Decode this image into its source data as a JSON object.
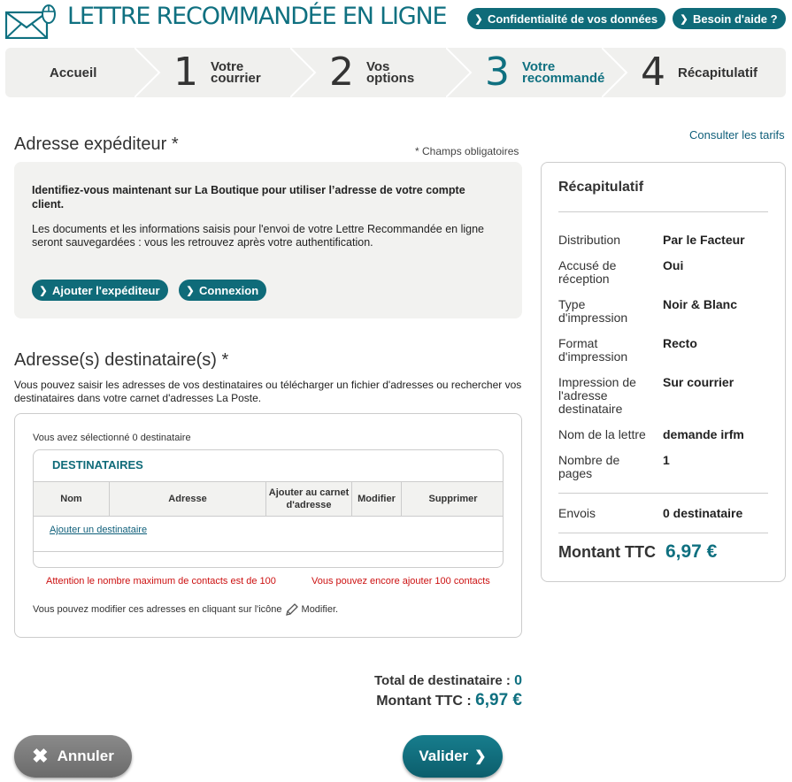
{
  "header": {
    "title": "LETTRE RECOMMANDÉE EN LIGNE",
    "logo_icon": "envelope-mouse-icon",
    "links": {
      "privacy": "Confidentialité de vos données",
      "help": "Besoin d'aide ?"
    }
  },
  "steps": {
    "home": "Accueil",
    "items": [
      {
        "num": "1",
        "label": "Votre courrier",
        "active": false
      },
      {
        "num": "2",
        "label": "Vos options",
        "active": false
      },
      {
        "num": "3",
        "label": "Votre recommandé",
        "active": true
      },
      {
        "num": "4",
        "label": "Récapitulatif",
        "active": false
      }
    ]
  },
  "tarifs_link": "Consulter les tarifs",
  "sender": {
    "title": "Adresse expéditeur *",
    "required_note": "* Champs obligatoires",
    "intro_bold": "Identifiez-vous maintenant sur La Boutique pour utiliser l’adresse de votre compte client.",
    "intro": "Les documents et les informations saisis pour l'envoi de votre Lettre Recommandée en ligne seront sauvegardées : vous les retrouvez après votre authentification.",
    "add_button": "Ajouter l'expéditeur",
    "login_button": "Connexion"
  },
  "recipients": {
    "title": "Adresse(s) destinataire(s) *",
    "intro": "Vous pouvez saisir les adresses de vos destinataires ou télécharger un fichier d'adresses ou rechercher vos destinataires dans votre carnet d'adresses La Poste.",
    "selected_text": "Vous avez sélectionné 0 destinataire",
    "table_title": "DESTINATAIRES",
    "columns": [
      "Nom",
      "Adresse",
      "Ajouter au carnet d'adresse",
      "Modifier",
      "Supprimer"
    ],
    "add_link": "Ajouter un destinataire",
    "warning_max": "Attention le nombre maximum de contacts est de 100",
    "warning_remaining": "Vous pouvez encore ajouter 100 contacts",
    "edit_note_before": "Vous pouvez modifier ces adresses en cliquant sur l'icône",
    "edit_note_after": "Modifier."
  },
  "recap": {
    "title": "Récapitulatif",
    "rows": [
      {
        "key": "Distribution",
        "value": "Par le Facteur"
      },
      {
        "key": "Accusé de réception",
        "value": "Oui"
      },
      {
        "key": "Type d'impression",
        "value": "Noir & Blanc"
      },
      {
        "key": "Format d'impression",
        "value": "Recto"
      },
      {
        "key": "Impression de l'adresse destinataire",
        "value": "Sur courrier"
      },
      {
        "key": "Nom de la lettre",
        "value": "demande irfm"
      },
      {
        "key": "Nombre de pages",
        "value": "1"
      },
      {
        "key": "Envois",
        "value": "0 destinataire"
      }
    ],
    "total_label": "Montant TTC",
    "total_value": "6,97 €"
  },
  "totals": {
    "dest_label": "Total de destinataire :",
    "dest_value": "0",
    "amount_label": "Montant TTC :",
    "amount_value": "6,97 €"
  },
  "actions": {
    "cancel": "Annuler",
    "validate": "Valider"
  },
  "colors": {
    "brand": "#0f7080",
    "pill": "#0f6b79",
    "warning": "#cc1111",
    "panel": "#f2f2f0"
  }
}
